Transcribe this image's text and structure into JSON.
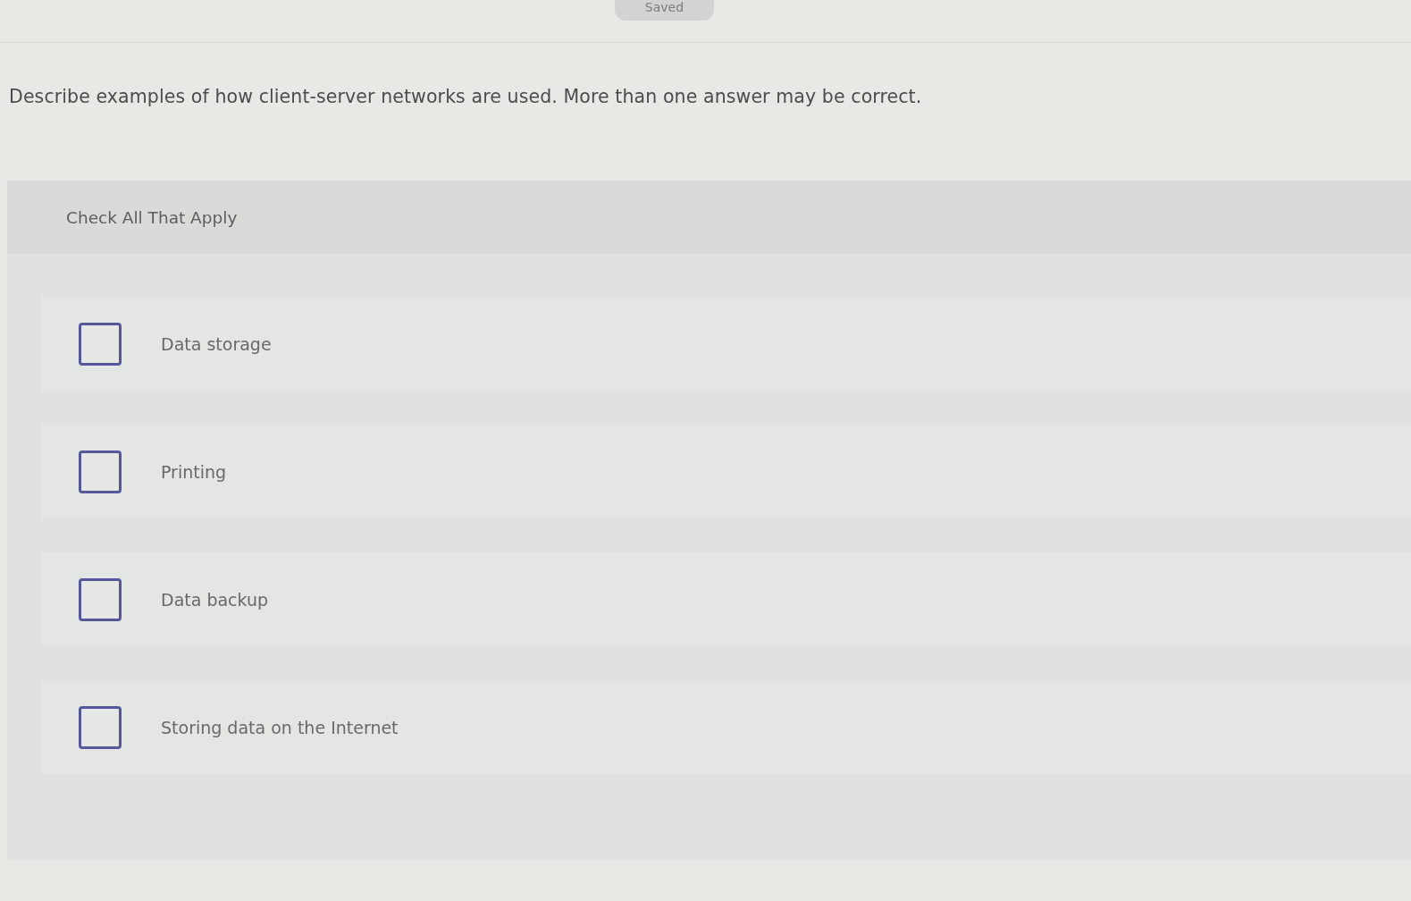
{
  "status_badge": {
    "label": "Saved"
  },
  "question": {
    "prompt": "Describe examples of how client-server networks are used. More than one answer may be correct.",
    "instruction": "Check All That Apply",
    "options": [
      {
        "label": "Data storage",
        "checked": false
      },
      {
        "label": "Printing",
        "checked": false
      },
      {
        "label": "Data backup",
        "checked": false
      },
      {
        "label": "Storing data on the Internet",
        "checked": false
      }
    ]
  }
}
